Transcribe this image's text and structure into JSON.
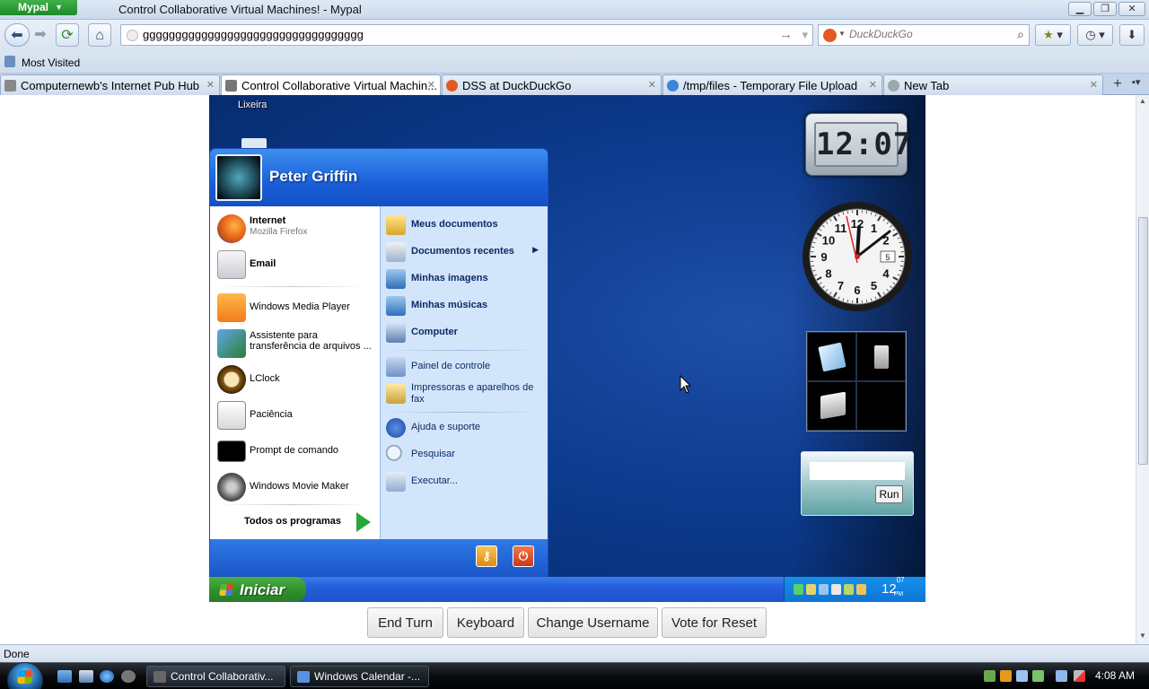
{
  "browser": {
    "app_menu": "Mypal",
    "window_title": "Control Collaborative Virtual Machines! - Mypal",
    "url": "gggggggggggggggggggggggggggggggggg",
    "search_placeholder": "DuckDuckGo",
    "bookmarks_label": "Most Visited",
    "tabs": [
      {
        "label": "Computernewb's Internet Pub Hub",
        "active": false
      },
      {
        "label": "Control Collaborative Virtual Machin...",
        "active": true
      },
      {
        "label": "DSS at DuckDuckGo",
        "active": false
      },
      {
        "label": "/tmp/files - Temporary File Upload",
        "active": false
      },
      {
        "label": "New Tab",
        "active": false
      }
    ],
    "status": "Done",
    "colors": {
      "accent": "#2a4f7c",
      "app_button": "#1c8a2a"
    }
  },
  "vm": {
    "desktop_icon_label": "Lixeira",
    "start_menu": {
      "username": "Peter Griffin",
      "pinned": [
        {
          "title": "Internet",
          "subtitle": "Mozilla Firefox",
          "icon": "firefox-icon"
        },
        {
          "title": "Email",
          "subtitle": "",
          "icon": "email-icon"
        }
      ],
      "recent": [
        {
          "title": "Windows Media Player",
          "icon": "media-player-icon"
        },
        {
          "title": "Assistente para",
          "title2": "transferência de arquivos ...",
          "icon": "transfer-wizard-icon"
        },
        {
          "title": "LClock",
          "icon": "clock-app-icon"
        },
        {
          "title": "Paciência",
          "icon": "solitaire-icon"
        },
        {
          "title": "Prompt de comando",
          "icon": "command-prompt-icon"
        },
        {
          "title": "Windows Movie Maker",
          "icon": "movie-maker-icon"
        }
      ],
      "all_programs": "Todos os programas",
      "places": [
        {
          "title": "Meus documentos",
          "icon": "documents-folder-icon"
        },
        {
          "title": "Documentos recentes",
          "icon": "recent-documents-icon"
        },
        {
          "title": "Minhas imagens",
          "icon": "pictures-folder-icon"
        },
        {
          "title": "Minhas músicas",
          "icon": "music-folder-icon"
        },
        {
          "title": "Computer",
          "icon": "computer-icon"
        }
      ],
      "system": [
        {
          "title": "Painel de controle",
          "icon": "control-panel-icon"
        },
        {
          "title": "Impressoras e aparelhos de",
          "title2": "fax",
          "icon": "printer-icon"
        }
      ],
      "help": [
        {
          "title": "Ajuda e suporte",
          "icon": "help-icon"
        },
        {
          "title": "Pesquisar",
          "icon": "search-icon"
        },
        {
          "title": "Executar...",
          "icon": "run-icon"
        }
      ]
    },
    "start_label": "Iniciar",
    "tray_time_hour": "12",
    "tray_time_min": "07",
    "tray_time_suffix": "PM",
    "gadget_digital_time": "12:07",
    "gadget_calendar_day": "5",
    "run_button": "Run",
    "run_input_value": "",
    "colors": {
      "taskbar": "#245edb",
      "start_button": "#2f8f2c"
    }
  },
  "controls": {
    "end_turn": "End Turn",
    "keyboard": "Keyboard",
    "change_username": "Change Username",
    "vote_reset": "Vote for Reset"
  },
  "host_taskbar": {
    "tasks": [
      {
        "label": "Control Collaborativ...",
        "active": true
      },
      {
        "label": "Windows Calendar -...",
        "active": false
      }
    ],
    "clock": "4:08 AM"
  }
}
